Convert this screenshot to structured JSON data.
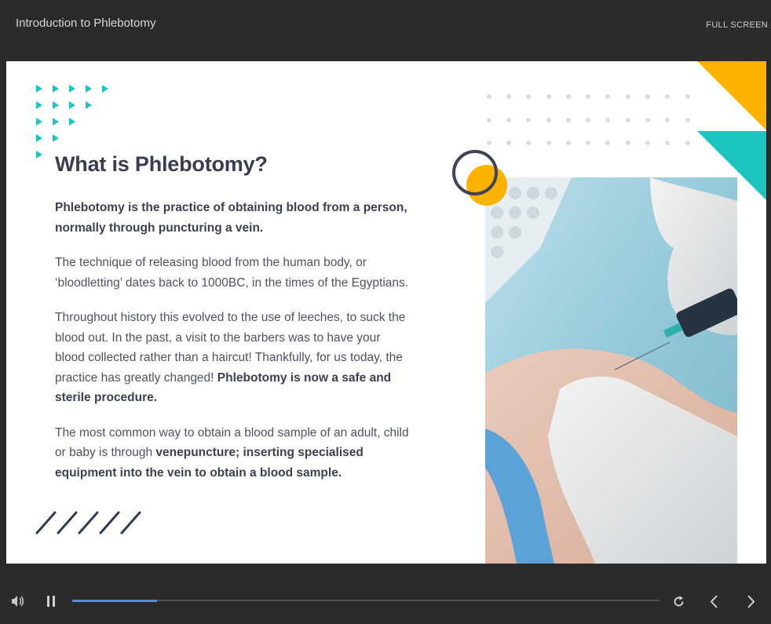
{
  "header": {
    "title": "Introduction to Phlebotomy",
    "fullscreen_label": "FULL SCREEN"
  },
  "slide": {
    "heading": "What is Phlebotomy?",
    "paragraphs": {
      "p1": "Phlebotomy is the practice of obtaining blood from a person, normally through puncturing a vein.",
      "p2": "The technique of releasing blood from the human body, or ‘bloodletting’ dates back to 1000BC, in the times of the Egyptians.",
      "p3_text": "Throughout history this evolved to the use of leeches, to suck the blood out. In the past, a visit to the barbers was to have your blood collected rather than a haircut! Thankfully, for us today, the practice has greatly changed! ",
      "p3_bold": "Phlebotomy is now a safe and sterile procedure.",
      "p4_text": "The most common way to obtain a blood sample of an adult, child or baby is through ",
      "p4_bold": "venepuncture; inserting specialised equipment into the vein to obtain a blood sample."
    },
    "image_alt": "Blood draw from arm using a syringe"
  },
  "player": {
    "progress_fraction": 0.145,
    "icons": [
      "volume-icon",
      "pause-icon",
      "replay-icon",
      "previous-icon",
      "next-icon"
    ]
  },
  "colors": {
    "teal": "#1cc6bf",
    "yellow": "#fcb200",
    "navy": "#3a3d52",
    "progress": "#5b8bd4"
  }
}
